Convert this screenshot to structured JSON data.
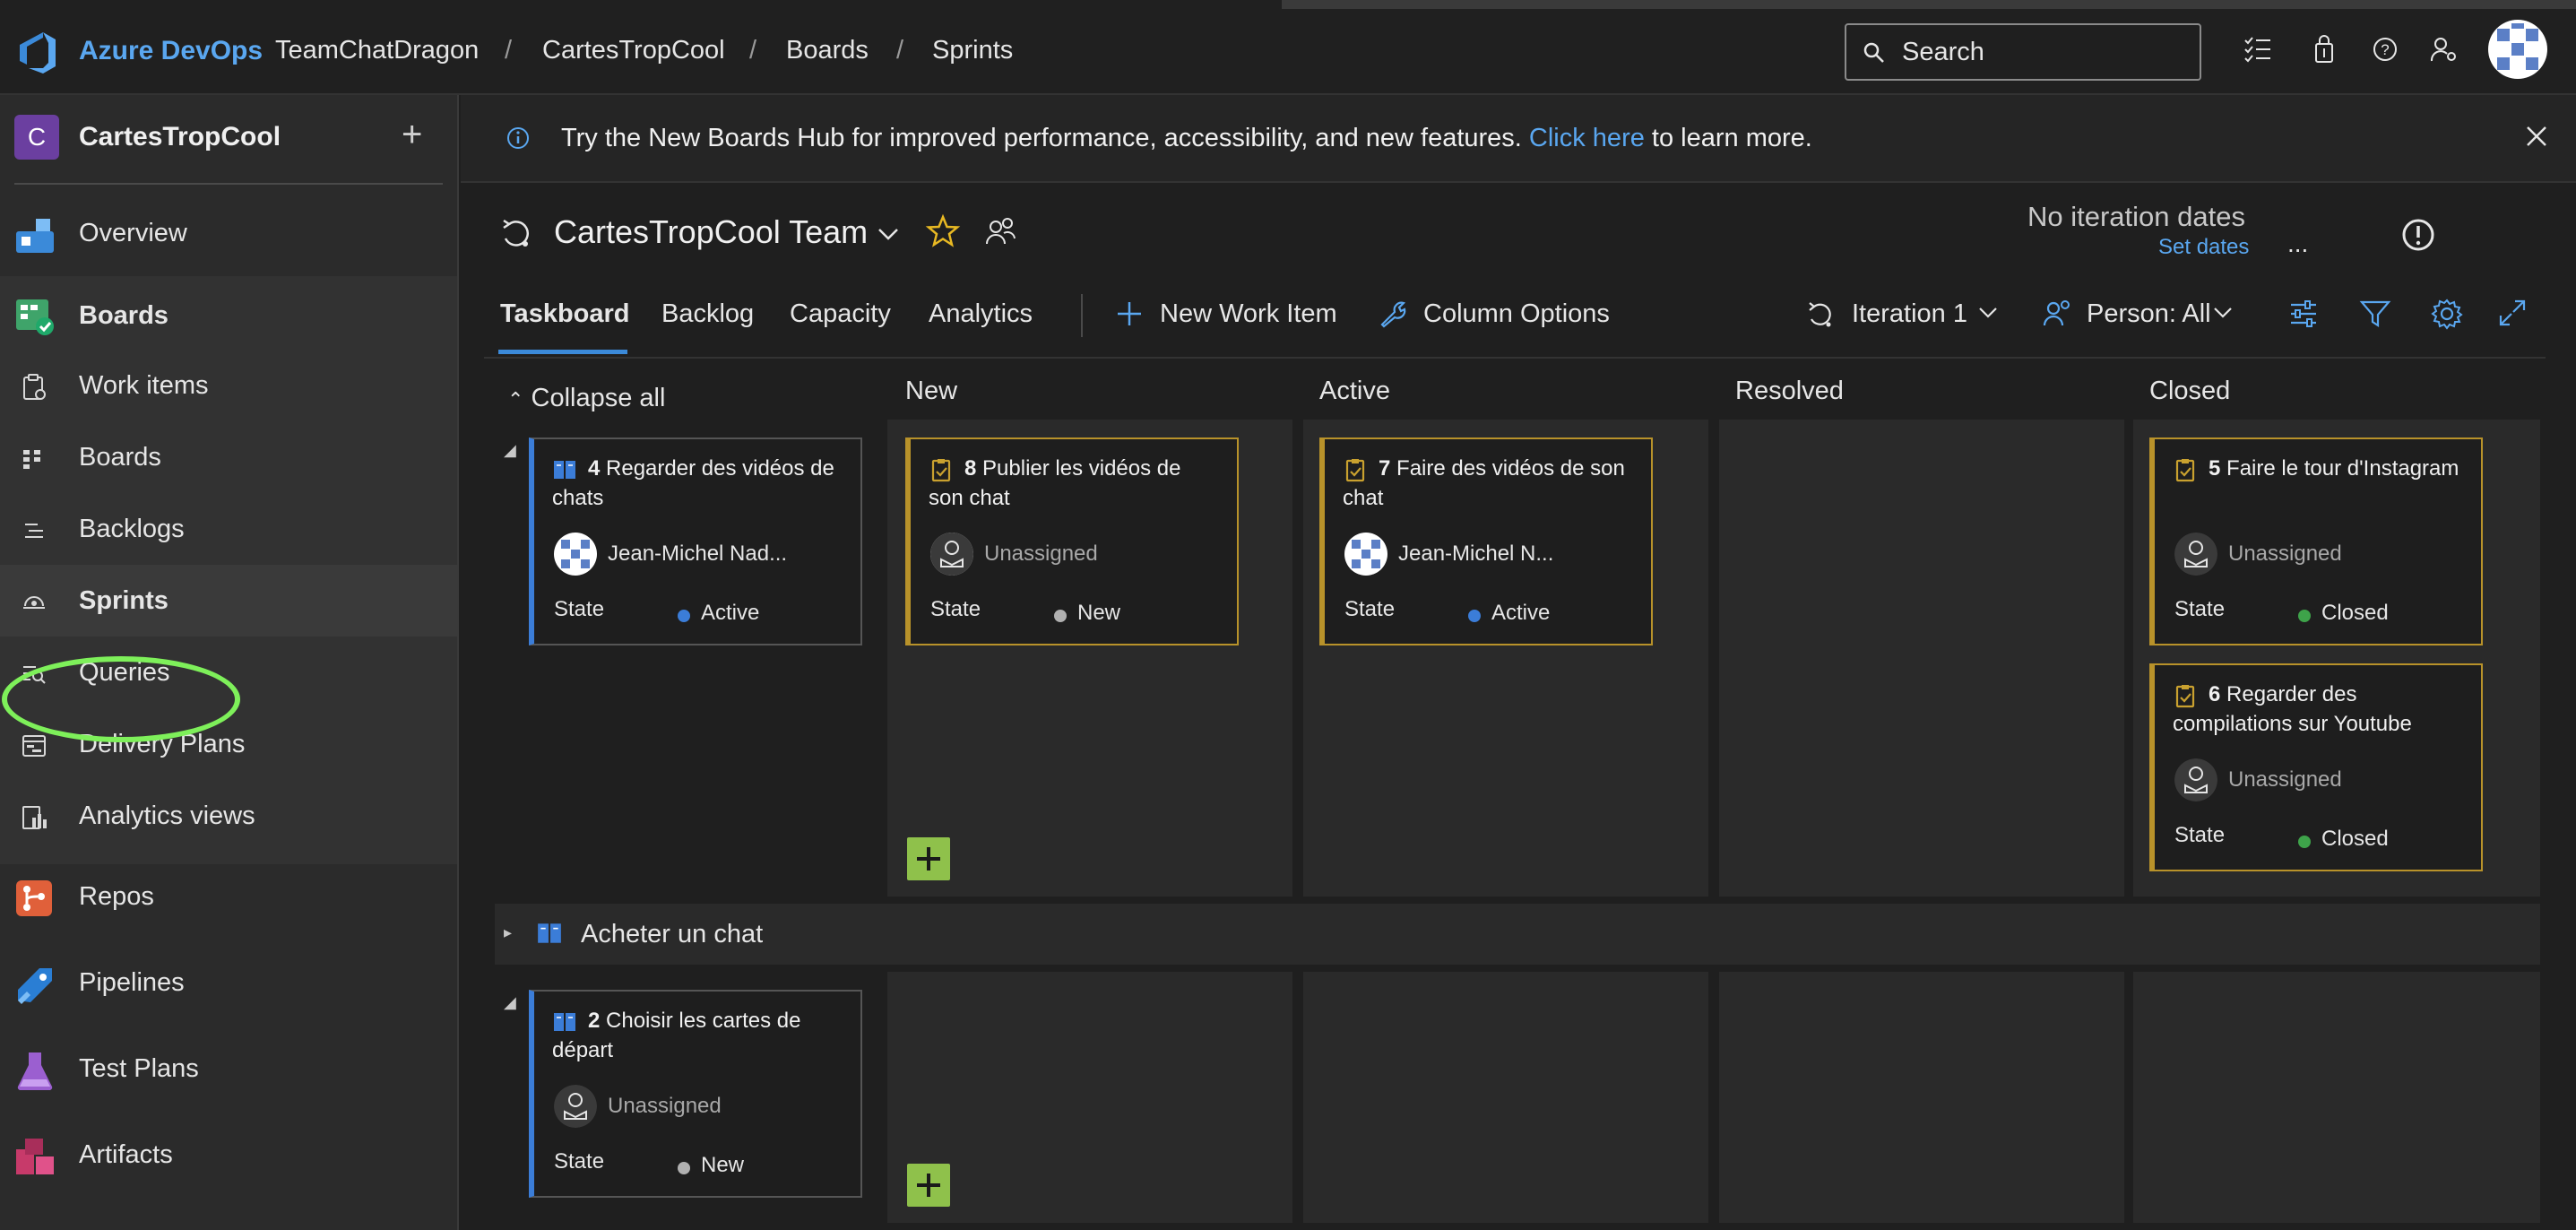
{
  "colors": {
    "accent": "#5aa7f0",
    "pbi": "#3b7dd8",
    "task": "#b8922a",
    "add": "#8fc14b",
    "highlight": "#7ef05a"
  },
  "header": {
    "brand": "Azure DevOps",
    "breadcrumbs": [
      "TeamChatDragon",
      "CartesTropCool",
      "Boards",
      "Sprints"
    ],
    "search_placeholder": "Search",
    "icons": [
      "checklist-icon",
      "shopping-bag-icon",
      "help-icon",
      "user-settings-icon",
      "avatar"
    ]
  },
  "sidebar": {
    "project_initial": "C",
    "project_name": "CartesTropCool",
    "add_label": "+",
    "items": [
      {
        "label": "Overview",
        "icon": "overview-icon"
      },
      {
        "label": "Boards",
        "icon": "boards-icon"
      },
      {
        "label": "Work items",
        "icon": "work-items-icon"
      },
      {
        "label": "Boards",
        "icon": "boards-sub-icon"
      },
      {
        "label": "Backlogs",
        "icon": "backlogs-icon"
      },
      {
        "label": "Sprints",
        "icon": "sprints-icon",
        "selected": true
      },
      {
        "label": "Queries",
        "icon": "queries-icon"
      },
      {
        "label": "Delivery Plans",
        "icon": "delivery-plans-icon"
      },
      {
        "label": "Analytics views",
        "icon": "analytics-views-icon"
      },
      {
        "label": "Repos",
        "icon": "repos-icon"
      },
      {
        "label": "Pipelines",
        "icon": "pipelines-icon"
      },
      {
        "label": "Test Plans",
        "icon": "test-plans-icon"
      },
      {
        "label": "Artifacts",
        "icon": "artifacts-icon"
      }
    ]
  },
  "banner": {
    "text": "Try the New Boards Hub for improved performance, accessibility, and new features.",
    "link": "Click here",
    "suffix": "to learn more."
  },
  "team": {
    "name": "CartesTropCool Team",
    "iteration_dates": "No iteration dates",
    "set_dates": "Set dates",
    "more": "..."
  },
  "tabs": [
    "Taskboard",
    "Backlog",
    "Capacity",
    "Analytics"
  ],
  "toolbar": {
    "new_work_item": "New Work Item",
    "column_options": "Column Options",
    "iteration": "Iteration 1",
    "person": "Person: All"
  },
  "board": {
    "collapse_all": "Collapse all",
    "columns": [
      "New",
      "Active",
      "Resolved",
      "Closed"
    ],
    "state_label": "State",
    "collapsed_row": "Acheter un chat",
    "cards": {
      "c4": {
        "id": "4",
        "title": "Regarder des vidéos de chats",
        "assignee": "Jean-Michel Nad...",
        "state": "Active"
      },
      "c8": {
        "id": "8",
        "title": "Publier les vidéos de son chat",
        "assignee": "Unassigned",
        "state": "New"
      },
      "c7": {
        "id": "7",
        "title": "Faire des vidéos de son chat",
        "assignee": "Jean-Michel N...",
        "state": "Active"
      },
      "c5": {
        "id": "5",
        "title": "Faire le tour d'Instagram",
        "assignee": "Unassigned",
        "state": "Closed"
      },
      "c6": {
        "id": "6",
        "title": "Regarder des compilations sur Youtube",
        "assignee": "Unassigned",
        "state": "Closed"
      },
      "c2": {
        "id": "2",
        "title": "Choisir les cartes de départ",
        "assignee": "Unassigned",
        "state": "New"
      }
    }
  }
}
